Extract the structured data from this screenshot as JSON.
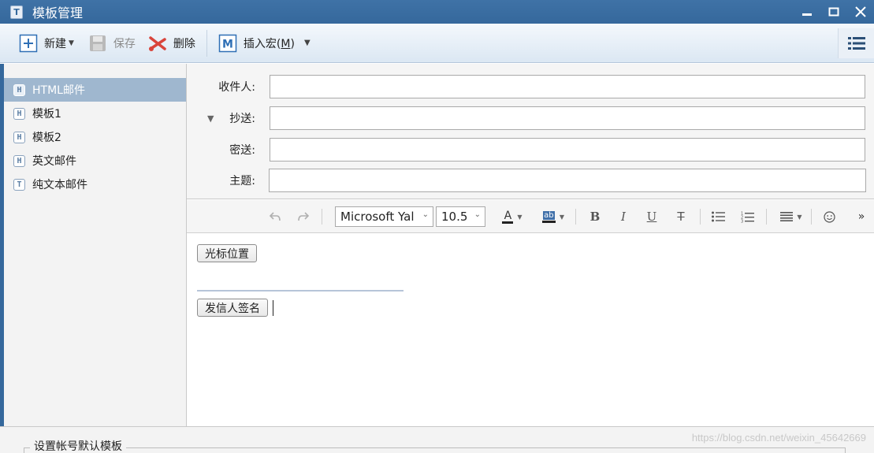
{
  "window": {
    "title": "模板管理",
    "icons": [
      "template-app-icon",
      "minimize-icon",
      "maximize-icon",
      "close-icon"
    ]
  },
  "toolbar": {
    "new_label": "新建",
    "save_label": "保存",
    "delete_label": "删除",
    "insert_macro_label": "插入宏(",
    "insert_macro_key": "M",
    "insert_macro_end": ")",
    "save_enabled": false
  },
  "templates": [
    {
      "label": "HTML邮件",
      "kind": "H",
      "selected": true
    },
    {
      "label": "模板1",
      "kind": "H",
      "selected": false
    },
    {
      "label": "模板2",
      "kind": "H",
      "selected": false
    },
    {
      "label": "英文邮件",
      "kind": "H",
      "selected": false
    },
    {
      "label": "纯文本邮件",
      "kind": "T",
      "selected": false
    }
  ],
  "form": {
    "to_label": "收件人:",
    "cc_label": "抄送:",
    "bcc_label": "密送:",
    "subject_label": "主题:",
    "to_value": "",
    "cc_value": "",
    "bcc_value": "",
    "subject_value": ""
  },
  "editor_toolbar": {
    "font_family": "Microsoft Yal",
    "font_size": "10.5",
    "font_color_glyph": "A",
    "highlight_glyph": "ab",
    "bold_glyph": "B",
    "italic_glyph": "I",
    "underline_glyph": "U",
    "strike_glyph": "T",
    "more_glyph": "»"
  },
  "editor": {
    "cursor_position_label": "光标位置",
    "sender_signature_label": "发信人签名"
  },
  "bottom": {
    "group_title": "设置帐号默认模板",
    "watermark": "https://blog.csdn.net/weixin_45642669"
  },
  "colors": {
    "titlebar": "#3f72a6",
    "selected_item": "#9fb7cf",
    "delete_icon": "#d9443b",
    "macro_icon": "#2f6fb5"
  }
}
